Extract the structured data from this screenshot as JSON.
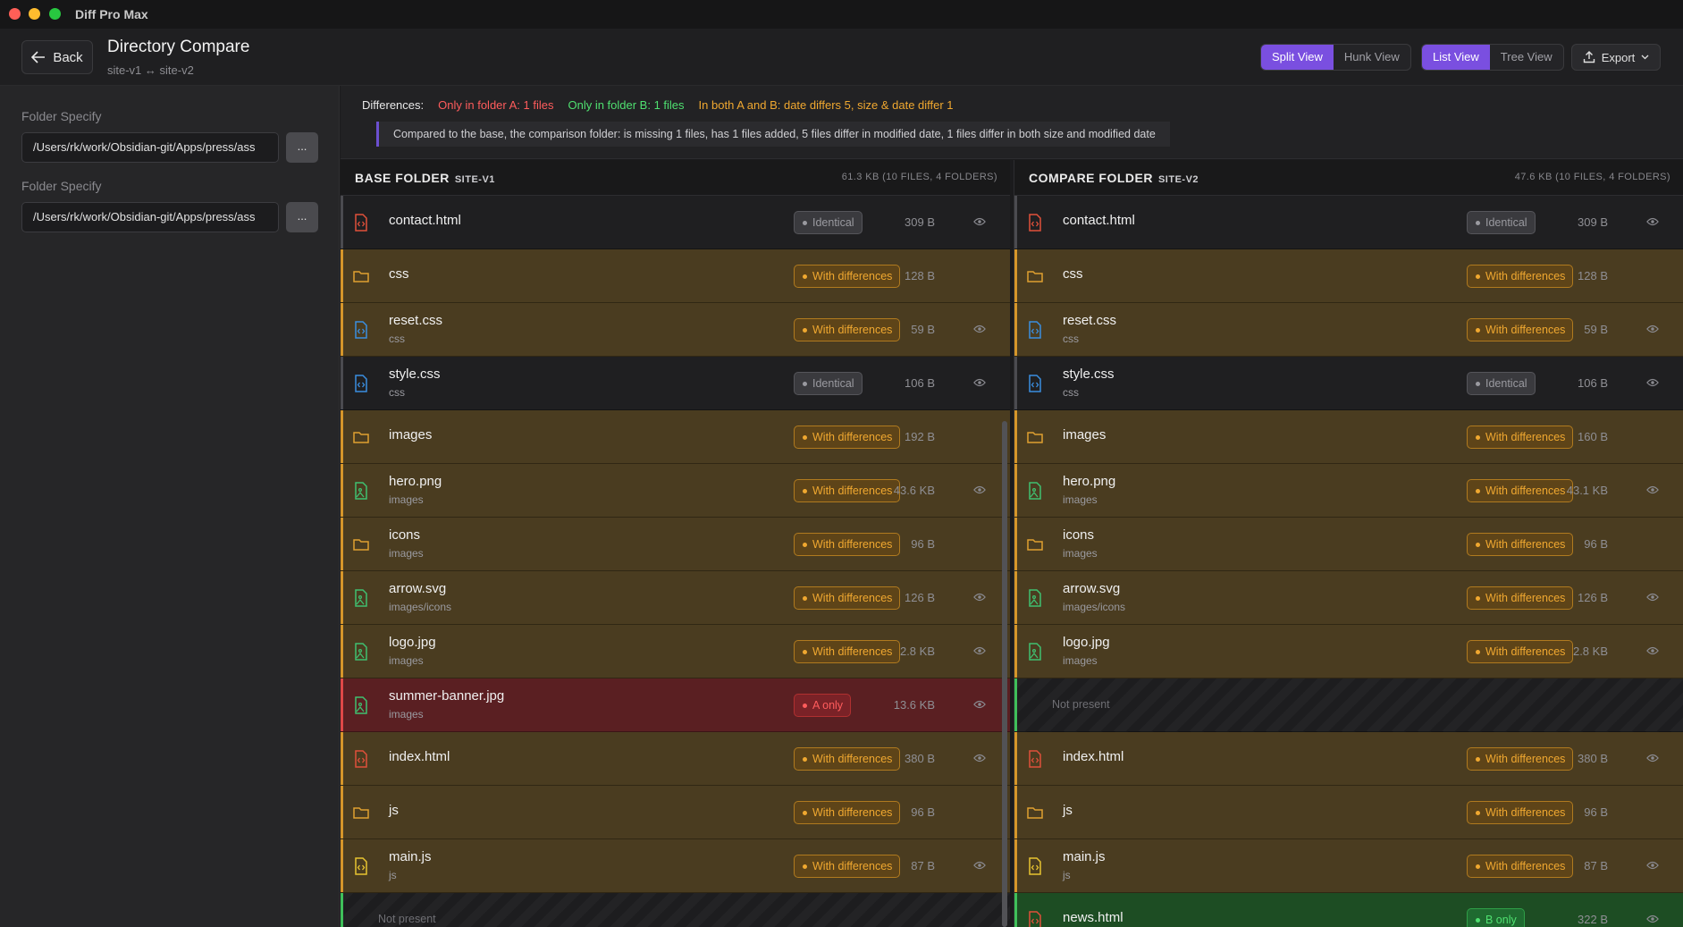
{
  "window": {
    "title": "Diff Pro Max"
  },
  "header": {
    "back_label": "Back",
    "title": "Directory Compare",
    "subtitle": "site-v1 ↔ site-v2"
  },
  "view_toggle": {
    "split": "Split View",
    "hunk": "Hunk View",
    "active": "Split View"
  },
  "mode_toggle": {
    "list": "List View",
    "tree": "Tree View",
    "active": "List View"
  },
  "export_label": "Export",
  "sidebar": {
    "folders": [
      {
        "label": "Folder Specify",
        "value": "/Users/rk/work/Obsidian-git/Apps/press/ass",
        "button": "..."
      },
      {
        "label": "Folder Specify",
        "value": "/Users/rk/work/Obsidian-git/Apps/press/ass",
        "button": "..."
      }
    ]
  },
  "differences": {
    "label": "Differences:",
    "only_a": "Only in folder A: 1 files",
    "only_b": "Only in folder B: 1 files",
    "both": "In both A and B: date differs 5, size & date differ 1",
    "summary": "Compared to the base, the comparison folder: is missing 1 files, has 1 files added, 5 files differ in modified date, 1 files differ in both size and modified date"
  },
  "colors": {
    "accent": "#7a4fe0",
    "diff": "#f0a830",
    "only_a": "#ff5c5c",
    "only_b": "#4fe070"
  },
  "base": {
    "title": "BASE FOLDER",
    "site": "SITE-V1",
    "stats": "61.3 KB (10 FILES, 4 FOLDERS)",
    "rows": [
      {
        "name": "contact.html",
        "sub": "",
        "icon": "html-file-icon",
        "status": "same",
        "badge": "Identical",
        "size": "309 B"
      },
      {
        "name": "css",
        "sub": "",
        "icon": "folder-icon",
        "status": "diff",
        "badge": "With differences",
        "size": "128 B"
      },
      {
        "name": "reset.css",
        "sub": "css",
        "icon": "css-file-icon",
        "status": "diff",
        "badge": "With differences",
        "size": "59 B"
      },
      {
        "name": "style.css",
        "sub": "css",
        "icon": "css-file-icon",
        "status": "same",
        "badge": "Identical",
        "size": "106 B"
      },
      {
        "name": "images",
        "sub": "",
        "icon": "folder-icon",
        "status": "diff",
        "badge": "With differences",
        "size": "192 B"
      },
      {
        "name": "hero.png",
        "sub": "images",
        "icon": "image-file-icon",
        "status": "diff",
        "badge": "With differences",
        "size": "43.6 KB"
      },
      {
        "name": "icons",
        "sub": "images",
        "icon": "folder-icon",
        "status": "diff",
        "badge": "With differences",
        "size": "96 B"
      },
      {
        "name": "arrow.svg",
        "sub": "images/icons",
        "icon": "image-file-icon",
        "status": "diff",
        "badge": "With differences",
        "size": "126 B"
      },
      {
        "name": "logo.jpg",
        "sub": "images",
        "icon": "image-file-icon",
        "status": "diff",
        "badge": "With differences",
        "size": "2.8 KB"
      },
      {
        "name": "summer-banner.jpg",
        "sub": "images",
        "icon": "image-file-icon",
        "status": "aonly",
        "badge": "A only",
        "size": "13.6 KB"
      },
      {
        "name": "index.html",
        "sub": "",
        "icon": "html-file-icon",
        "status": "diff",
        "badge": "With differences",
        "size": "380 B"
      },
      {
        "name": "js",
        "sub": "",
        "icon": "folder-icon",
        "status": "diff",
        "badge": "With differences",
        "size": "96 B"
      },
      {
        "name": "main.js",
        "sub": "js",
        "icon": "js-file-icon",
        "status": "diff",
        "badge": "With differences",
        "size": "87 B"
      },
      {
        "name": "Not present",
        "sub": "",
        "icon": "",
        "status": "none",
        "badge": "",
        "size": ""
      }
    ]
  },
  "compare": {
    "title": "COMPARE FOLDER",
    "site": "SITE-V2",
    "stats": "47.6 KB (10 FILES, 4 FOLDERS)",
    "rows": [
      {
        "name": "contact.html",
        "sub": "",
        "icon": "html-file-icon",
        "status": "same",
        "badge": "Identical",
        "size": "309 B"
      },
      {
        "name": "css",
        "sub": "",
        "icon": "folder-icon",
        "status": "diff",
        "badge": "With differences",
        "size": "128 B"
      },
      {
        "name": "reset.css",
        "sub": "css",
        "icon": "css-file-icon",
        "status": "diff",
        "badge": "With differences",
        "size": "59 B"
      },
      {
        "name": "style.css",
        "sub": "css",
        "icon": "css-file-icon",
        "status": "same",
        "badge": "Identical",
        "size": "106 B"
      },
      {
        "name": "images",
        "sub": "",
        "icon": "folder-icon",
        "status": "diff",
        "badge": "With differences",
        "size": "160 B"
      },
      {
        "name": "hero.png",
        "sub": "images",
        "icon": "image-file-icon",
        "status": "diff",
        "badge": "With differences",
        "size": "43.1 KB"
      },
      {
        "name": "icons",
        "sub": "images",
        "icon": "folder-icon",
        "status": "diff",
        "badge": "With differences",
        "size": "96 B"
      },
      {
        "name": "arrow.svg",
        "sub": "images/icons",
        "icon": "image-file-icon",
        "status": "diff",
        "badge": "With differences",
        "size": "126 B"
      },
      {
        "name": "logo.jpg",
        "sub": "images",
        "icon": "image-file-icon",
        "status": "diff",
        "badge": "With differences",
        "size": "2.8 KB"
      },
      {
        "name": "Not present",
        "sub": "",
        "icon": "",
        "status": "none",
        "badge": "",
        "size": ""
      },
      {
        "name": "index.html",
        "sub": "",
        "icon": "html-file-icon",
        "status": "diff",
        "badge": "With differences",
        "size": "380 B"
      },
      {
        "name": "js",
        "sub": "",
        "icon": "folder-icon",
        "status": "diff",
        "badge": "With differences",
        "size": "96 B"
      },
      {
        "name": "main.js",
        "sub": "js",
        "icon": "js-file-icon",
        "status": "diff",
        "badge": "With differences",
        "size": "87 B"
      },
      {
        "name": "news.html",
        "sub": "",
        "icon": "html-file-icon",
        "status": "bonly",
        "badge": "B only",
        "size": "322 B"
      }
    ]
  }
}
